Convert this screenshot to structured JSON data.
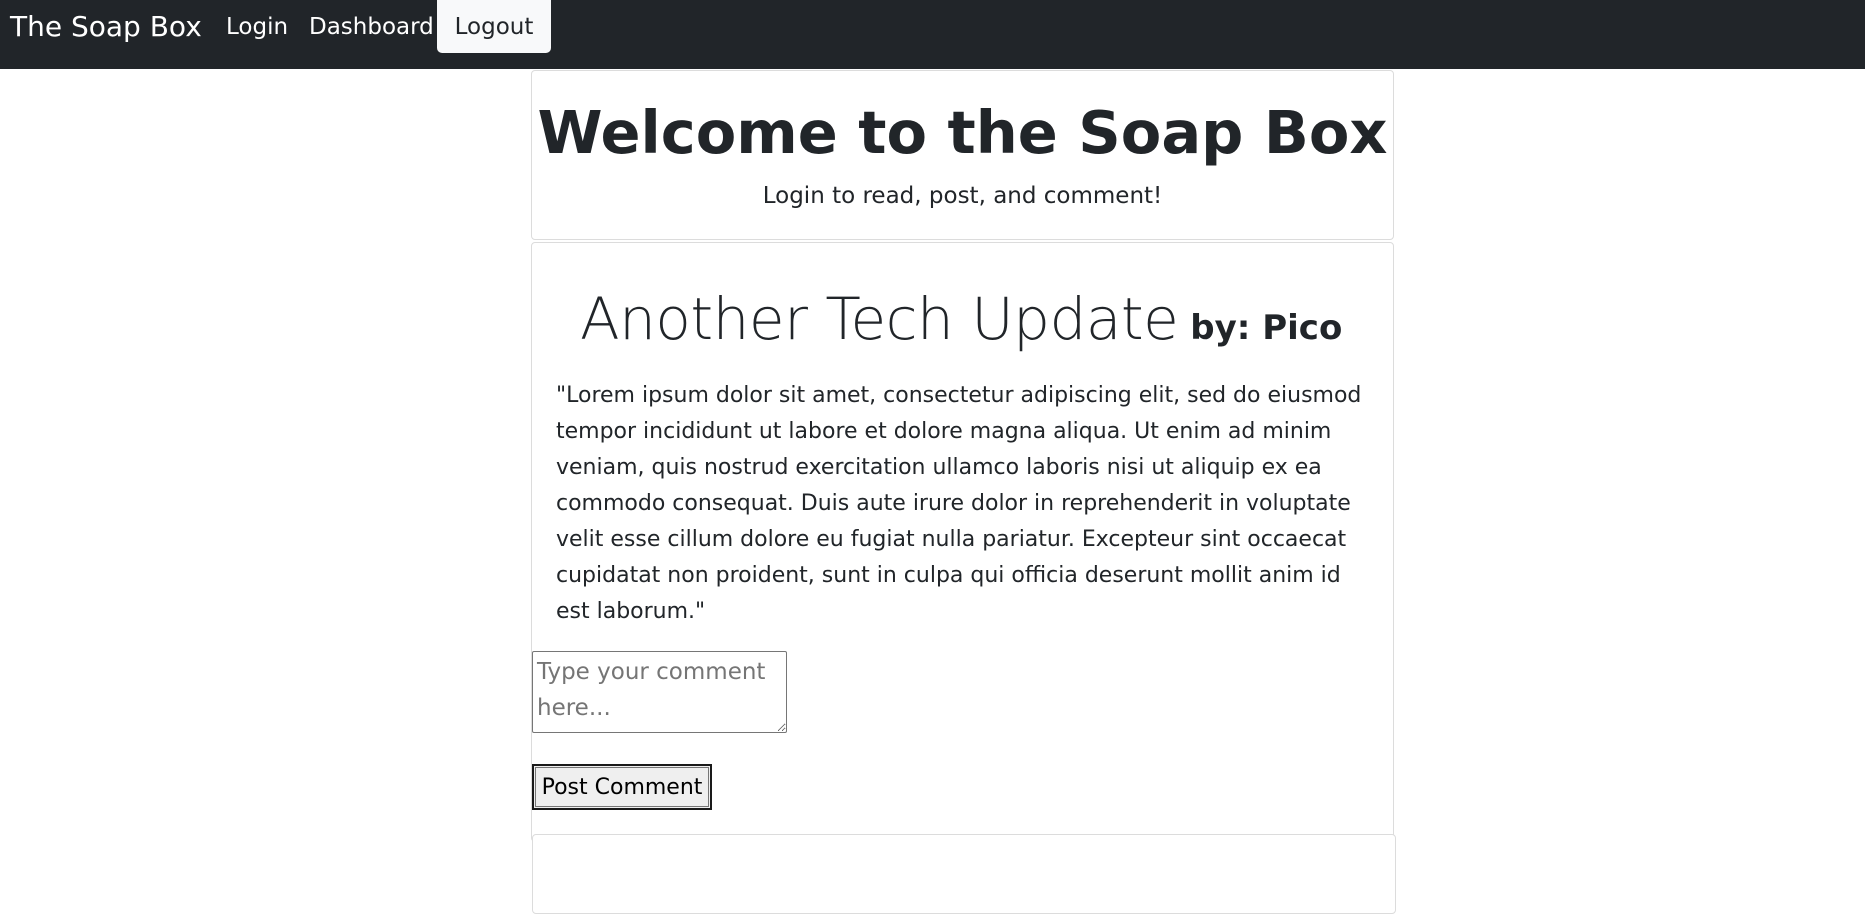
{
  "navbar": {
    "brand": "The Soap Box",
    "login_label": "Login",
    "dashboard_label": "Dashboard",
    "logout_label": "Logout",
    "background_color": "#212529"
  },
  "welcome": {
    "title": "Welcome to the Soap Box",
    "subtitle": "Login to read, post, and comment!"
  },
  "post": {
    "title": "Another Tech Update",
    "author": "by: Pico",
    "body": "\"Lorem ipsum dolor sit amet, consectetur adipiscing elit, sed do eiusmod tempor incididunt ut labore et dolore magna aliqua. Ut enim ad minim veniam, quis nostrud exercitation ullamco laboris nisi ut aliquip ex ea commodo consequat. Duis aute irure dolor in reprehenderit in voluptate velit esse cillum dolore eu fugiat nulla pariatur. Excepteur sint occaecat cupidatat non proident, sunt in culpa qui officia deserunt mollit anim id est laborum.\""
  },
  "comment": {
    "value": "",
    "placeholder": "Type your comment here...",
    "submit_label": "Post Comment"
  }
}
